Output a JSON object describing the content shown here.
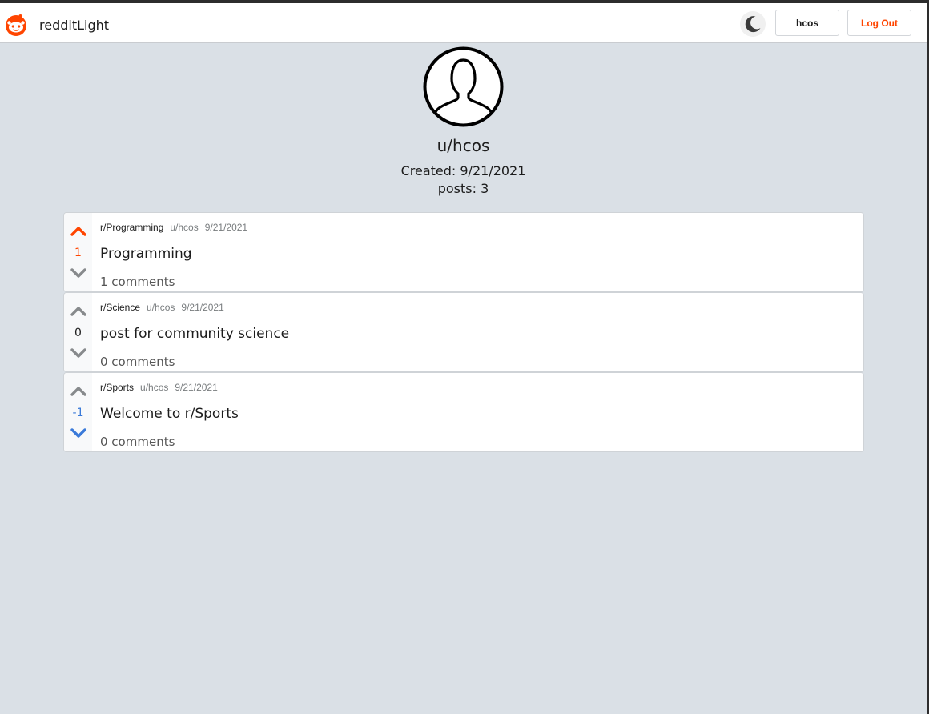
{
  "app": {
    "title": "redditLight"
  },
  "header": {
    "user_label": "hcos",
    "logout_label": "Log Out"
  },
  "profile": {
    "username": "u/hcos",
    "created": "Created: 9/21/2021",
    "posts_count": "posts: 3"
  },
  "posts": [
    {
      "subreddit": "r/Programming",
      "author": "u/hcos",
      "date": "9/21/2021",
      "votes": "1",
      "vote_state": "up",
      "title": "Programming",
      "comments": "1 comments"
    },
    {
      "subreddit": "r/Science",
      "author": "u/hcos",
      "date": "9/21/2021",
      "votes": "0",
      "vote_state": "none",
      "title": "post for community science",
      "comments": "0 comments"
    },
    {
      "subreddit": "r/Sports",
      "author": "u/hcos",
      "date": "9/21/2021",
      "votes": "-1",
      "vote_state": "down",
      "title": "Welcome to r/Sports",
      "comments": "0 comments"
    }
  ],
  "colors": {
    "brand": "#ff4500",
    "upvote": "#ff4500",
    "downvote": "#3a7ad9",
    "neutral_arrow": "#878a8c",
    "background": "#dae0e6"
  },
  "icons": {
    "logo": "reddit-logo-icon",
    "theme_toggle": "moon-icon",
    "avatar": "user-silhouette-icon",
    "upvote": "chevron-up-icon",
    "downvote": "chevron-down-icon"
  }
}
